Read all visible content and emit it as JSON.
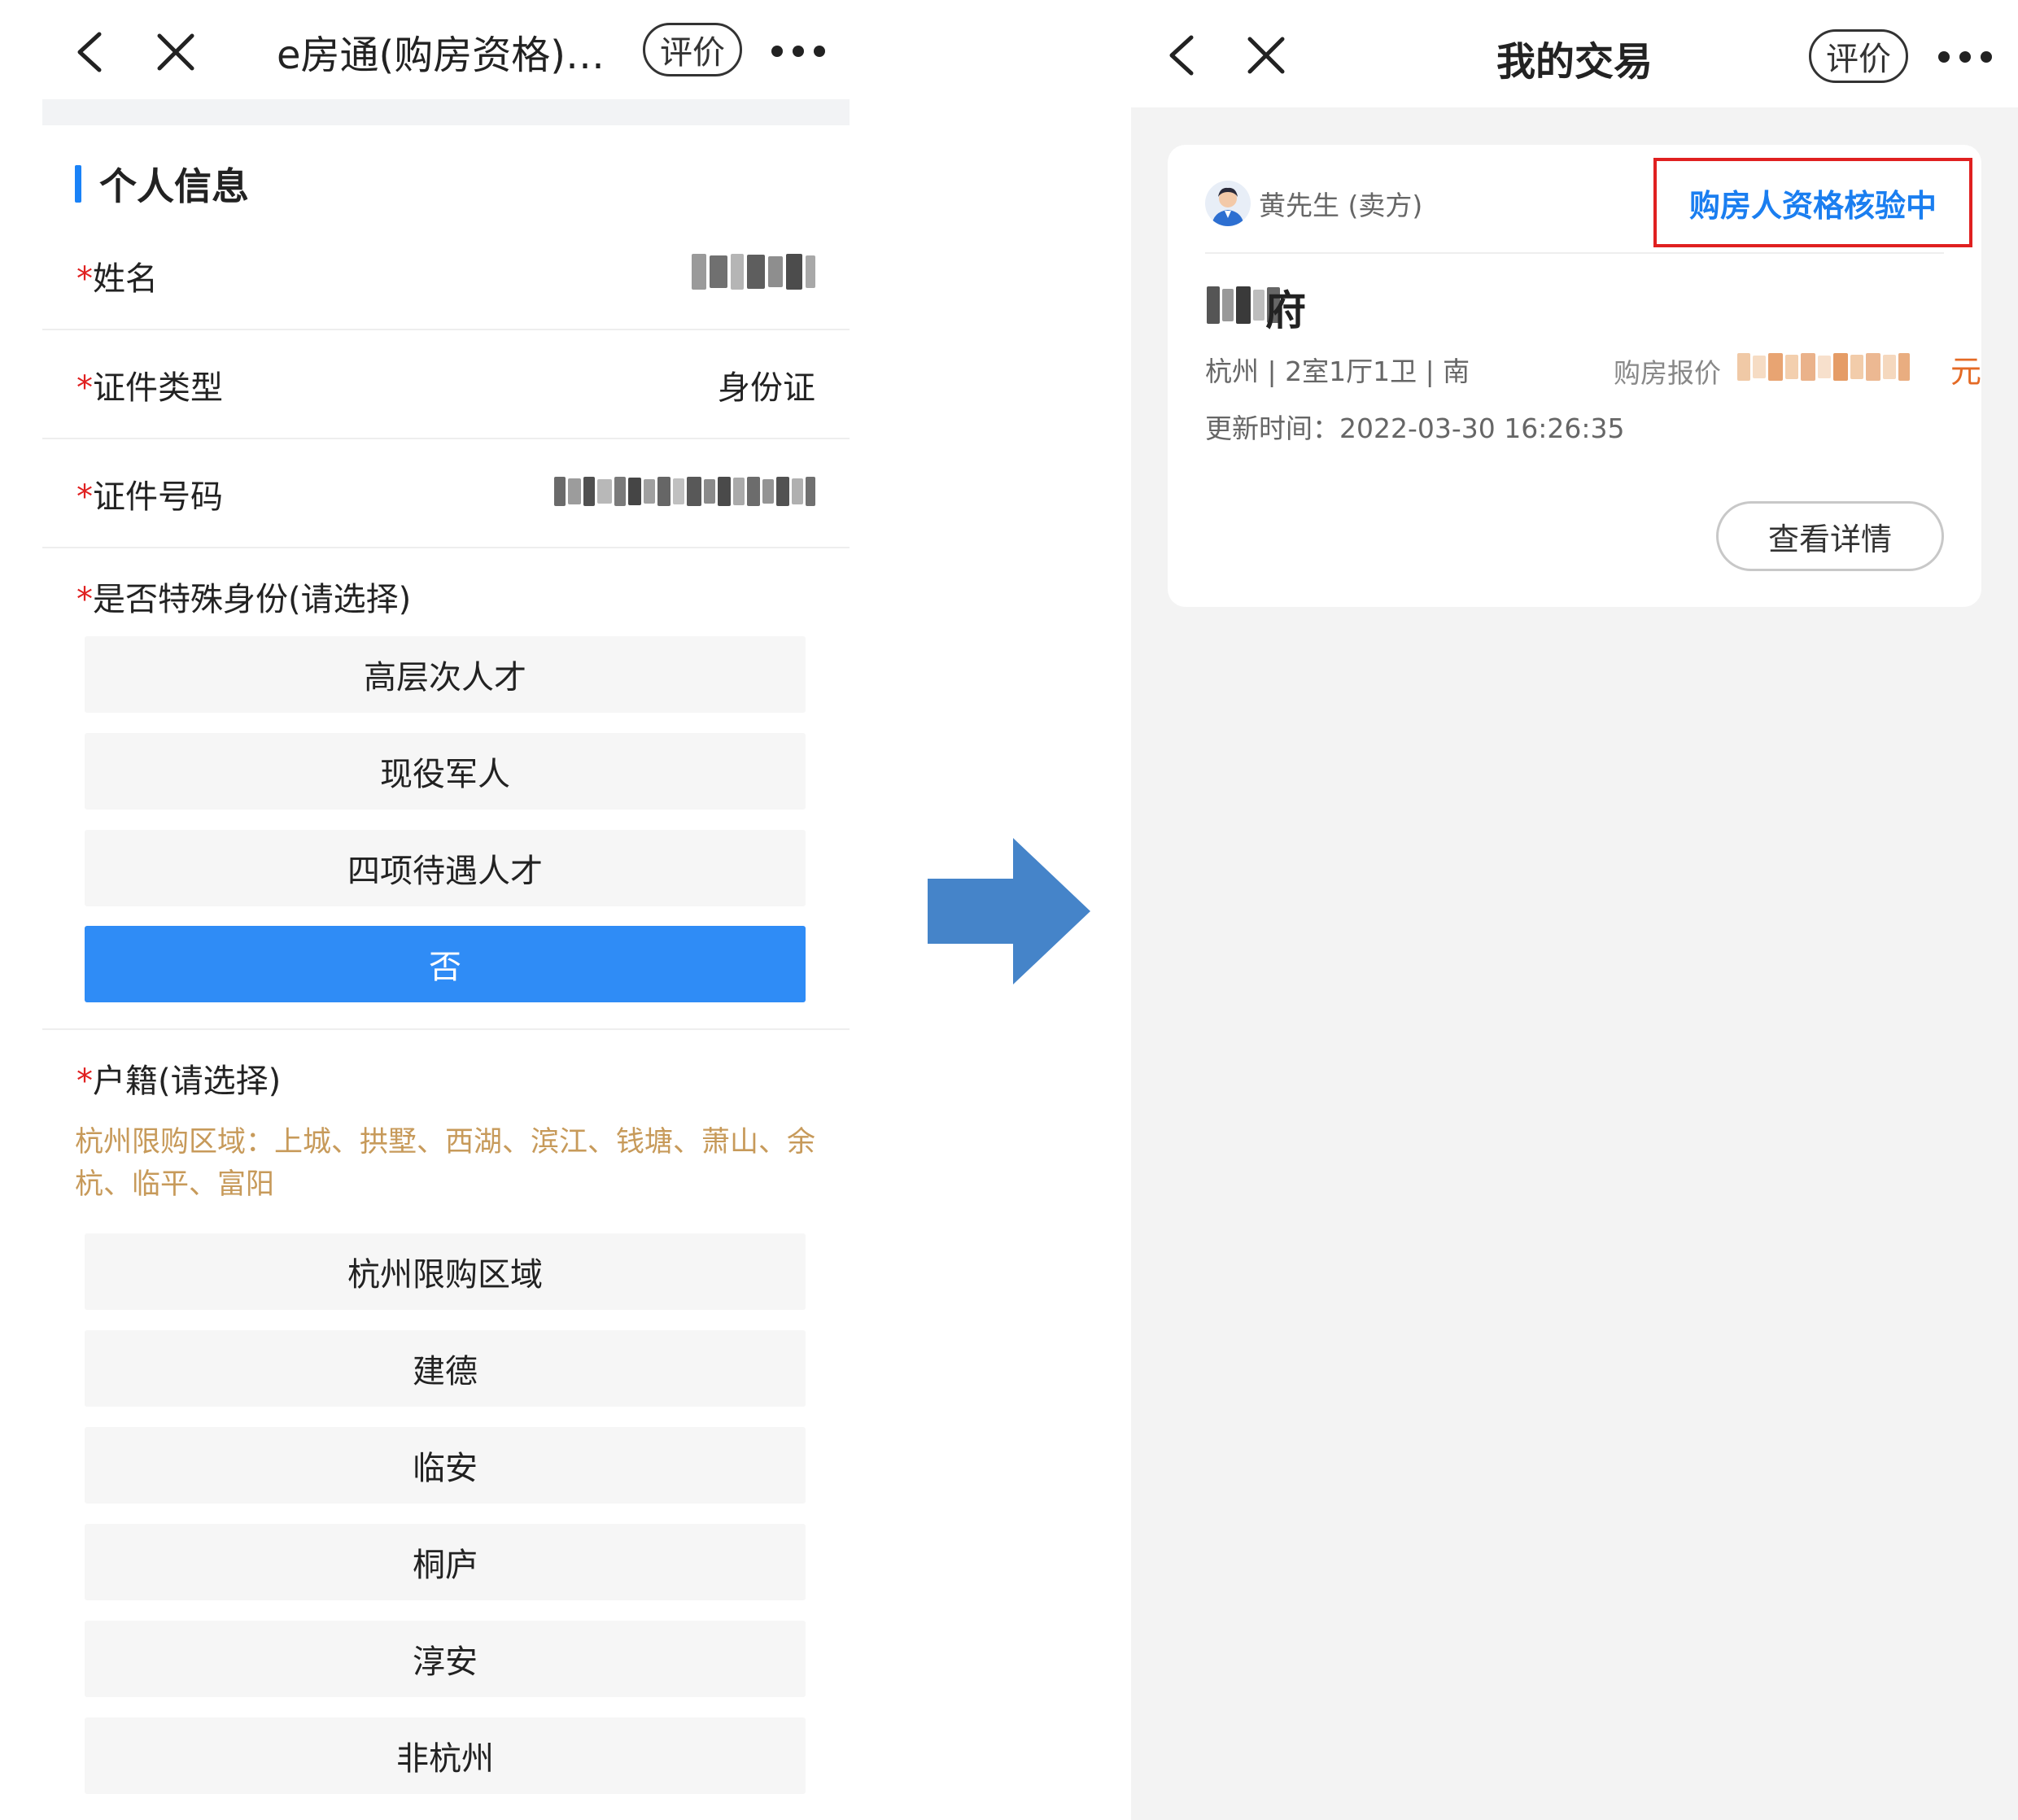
{
  "left": {
    "nav": {
      "title": "e房通(购房资格)…",
      "rate_label": "评价",
      "back_icon": "chevron-left-icon",
      "close_icon": "close-icon",
      "more_icon": "more-dots-icon"
    },
    "section_title": "个人信息",
    "fields": [
      {
        "label": "姓名",
        "value": ""
      },
      {
        "label": "证件类型",
        "value": "身份证"
      },
      {
        "label": "证件号码",
        "value": ""
      }
    ],
    "required_mark": "*",
    "special_identity": {
      "label": "是否特殊身份(请选择)",
      "options": [
        "高层次人才",
        "现役军人",
        "四项待遇人才",
        "否"
      ],
      "selected": "否"
    },
    "household": {
      "label": "户籍(请选择)",
      "hint": "杭州限购区域：上城、拱墅、西湖、滨江、钱塘、萧山、余杭、临平、富阳",
      "options": [
        "杭州限购区域",
        "建德",
        "临安",
        "桐庐",
        "淳安",
        "非杭州"
      ]
    },
    "colors": {
      "accent": "#2f8cf6",
      "required": "#e02020",
      "hint": "#c79a5a"
    }
  },
  "arrow": {
    "icon": "arrow-right-icon",
    "color": "#4584c9"
  },
  "right": {
    "nav": {
      "title": "我的交易",
      "rate_label": "评价"
    },
    "card": {
      "seller": "黄先生 (卖方)",
      "status": "购房人资格核验中",
      "property_suffix": "府",
      "meta": "杭州 | 2室1厅1卫 | 南",
      "price_label": "购房报价",
      "price_unit": "元",
      "updated": "更新时间：2022-03-30 16:26:35",
      "detail_button": "查看详情"
    },
    "colors": {
      "status": "#1a7ef0",
      "status_border": "#e02020",
      "price": "#e46a25"
    }
  }
}
